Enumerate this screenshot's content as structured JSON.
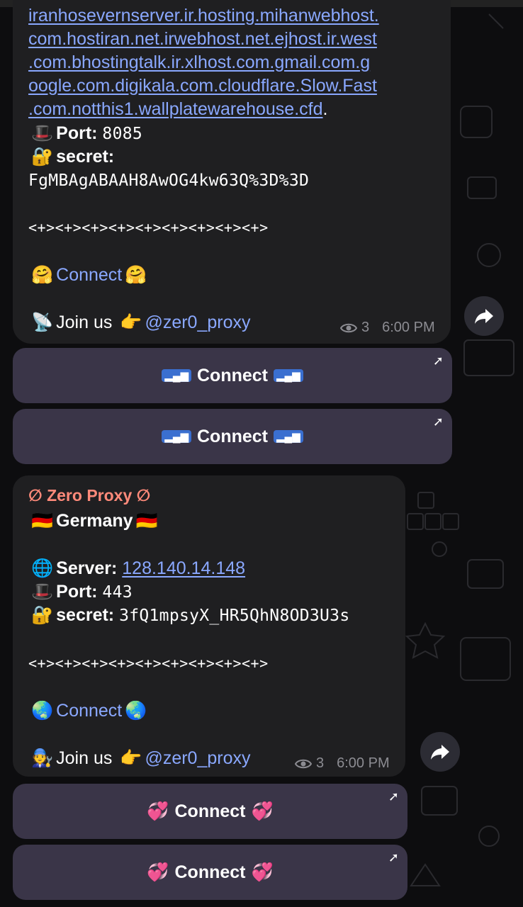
{
  "messages": [
    {
      "link_lines": [
        "iranhosevernserver.ir.hosting.mihanwebhost.",
        "com.hostiran.net.irwebhost.net.ejhost.ir.west",
        ".com.bhostingtalk.ir.xlhost.com.gmail.com.g",
        "oogle.com.digikala.com.cloudflare.Slow.Fast",
        ".com.notthis1.wallplatewarehouse.cfd"
      ],
      "link_tail": ".",
      "port_label": "Port:",
      "port_value": "8085",
      "secret_label": "secret:",
      "secret_value": "FgMBAgABAAH8AwOG4kw63Q%3D%3D",
      "separator": "<+><+><+><+><+><+><+><+><+>",
      "connect_link": "Connect",
      "join_text": "Join us",
      "channel": "@zer0_proxy",
      "views": "3",
      "time": "6:00 PM",
      "buttons": [
        "Connect",
        "Connect"
      ]
    },
    {
      "title": "∅ Zero Proxy ∅",
      "country": "Germany",
      "server_label": "Server:",
      "server_value": "128.140.14.148",
      "port_label": "Port:",
      "port_value": "443",
      "secret_label": "secret:",
      "secret_value": "3fQ1mpsyX_HR5QhN8OD3U3s",
      "separator": "<+><+><+><+><+><+><+><+><+>",
      "connect_link": "Connect",
      "join_text": "Join us",
      "channel": "@zer0_proxy",
      "views": "3",
      "time": "6:00 PM",
      "buttons": [
        "Connect",
        "Connect"
      ]
    }
  ],
  "icons": {
    "forward": "forward-arrow-icon",
    "views": "eye-icon",
    "external": "external-link-arrow-icon"
  },
  "colors": {
    "bubble": "#1f1f21",
    "link": "#8aa8ff",
    "button": "#3a3548",
    "title": "#ff8a7a",
    "meta": "#8c8c92"
  }
}
